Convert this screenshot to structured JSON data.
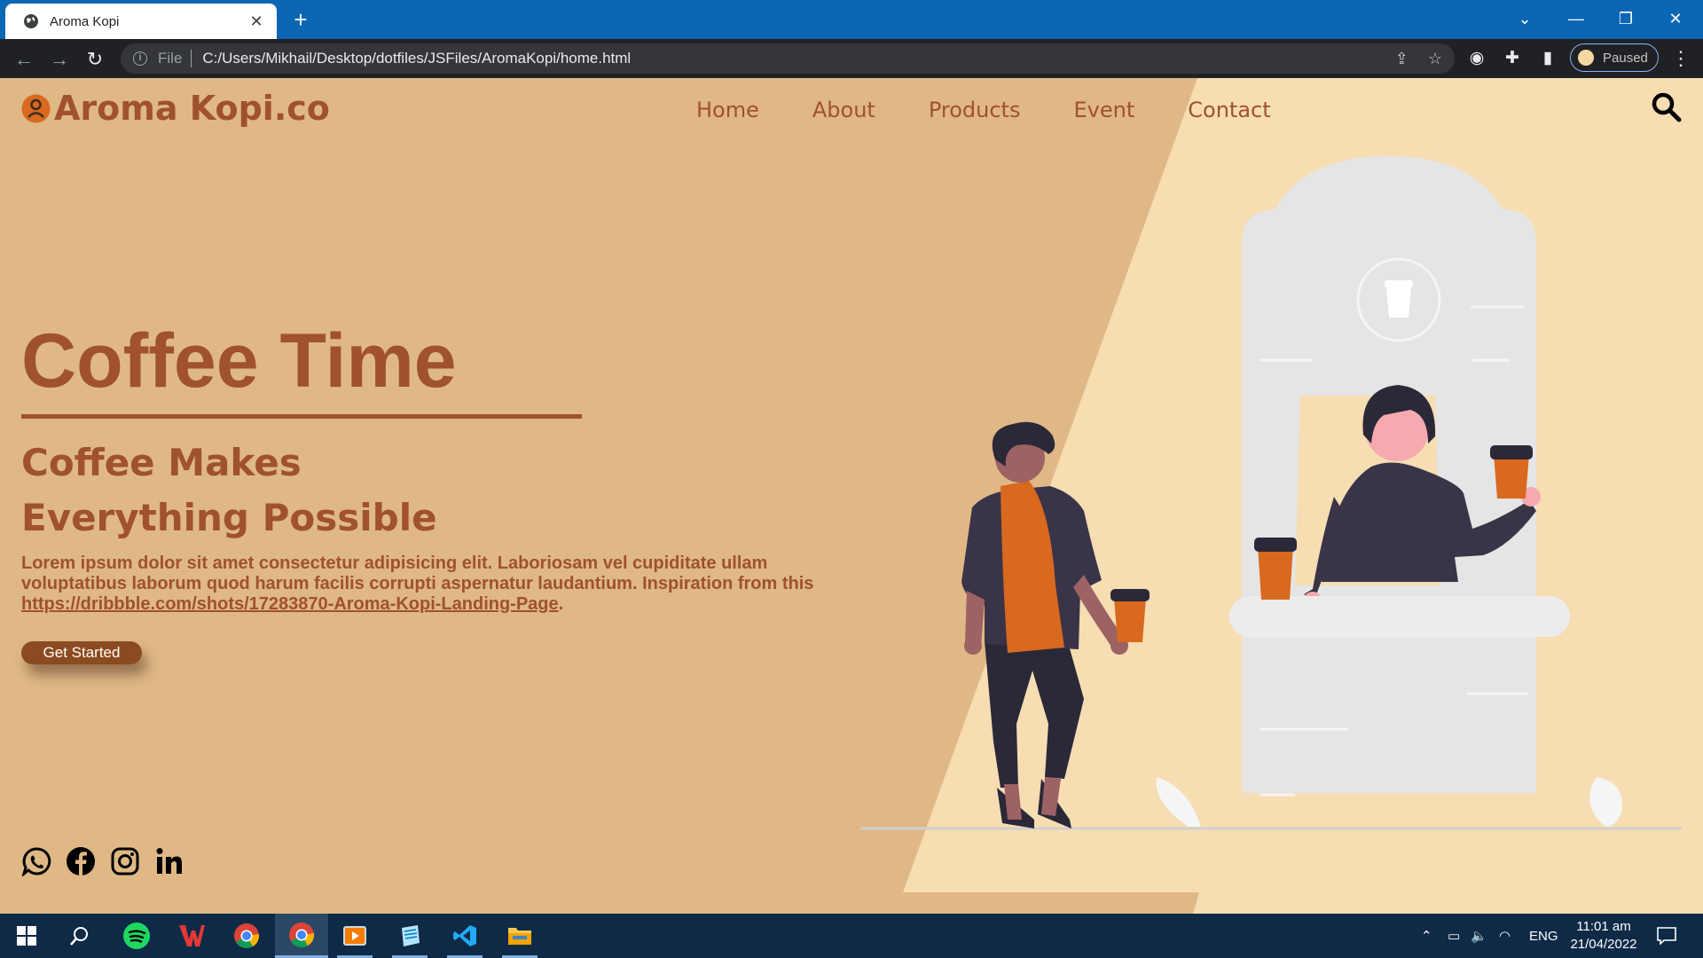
{
  "browser": {
    "tab_title": "Aroma Kopi",
    "tab_close": "✕",
    "new_tab": "+",
    "address_scheme": "File",
    "address_url": "C:/Users/Mikhail/Desktop/dotfiles/JSFiles/AromaKopi/home.html",
    "profile_status": "Paused",
    "window_controls": [
      "minimize",
      "restore",
      "close"
    ]
  },
  "site": {
    "logo_text": "Aroma Kopi.co",
    "nav": [
      "Home",
      "About",
      "Products",
      "Event",
      "Contact"
    ],
    "hero_title": "Coffee Time",
    "hero_subtitle": "Coffee Makes Everything Possible",
    "hero_description": "Lorem ipsum dolor sit amet consectetur adipisicing elit. Laboriosam vel cupiditate ullam voluptatibus laborum quod harum facilis corrupti aspernatur laudantium. Inspiration from this",
    "hero_link": "https://dribbble.com/shots/17283870-Aroma-Kopi-Landing-Page",
    "hero_link_suffix": ".",
    "cta_label": "Get Started",
    "socials": [
      "whatsapp-icon",
      "facebook-icon",
      "instagram-icon",
      "linkedin-icon"
    ]
  },
  "colors": {
    "accent": "#a0512d",
    "page_bg": "#dfb886",
    "panel_bg": "#f6ddb2",
    "button": "#8b4a1f",
    "tabbar": "#0b66b3",
    "taskbar": "#0e2a47"
  },
  "taskbar": {
    "apps": [
      "windows-start",
      "search",
      "spotify",
      "wps-office",
      "chrome",
      "chrome-active",
      "media-player",
      "notepad",
      "vscode",
      "file-explorer"
    ],
    "language": "ENG",
    "time": "11:01 am",
    "date": "21/04/2022"
  }
}
